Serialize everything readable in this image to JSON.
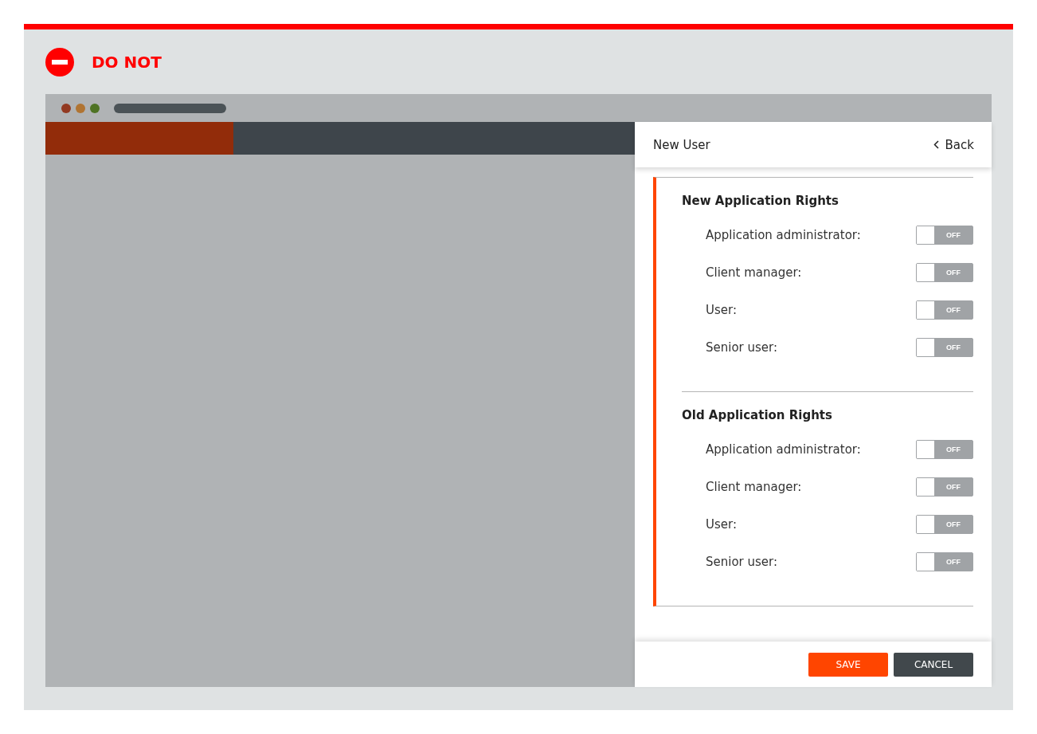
{
  "banner": {
    "label": "DO NOT"
  },
  "panel": {
    "title": "New User",
    "back": "Back",
    "sections": [
      {
        "title": "New Application Rights",
        "rights": [
          {
            "label": "Application administrator:",
            "on": false,
            "state_text": "OFF"
          },
          {
            "label": "Client manager:",
            "on": false,
            "state_text": "OFF"
          },
          {
            "label": "User:",
            "on": false,
            "state_text": "OFF"
          },
          {
            "label": "Senior user:",
            "on": false,
            "state_text": "OFF"
          }
        ]
      },
      {
        "title": "Old Application Rights",
        "rights": [
          {
            "label": "Application administrator:",
            "on": false,
            "state_text": "OFF"
          },
          {
            "label": "Client manager:",
            "on": false,
            "state_text": "OFF"
          },
          {
            "label": "User:",
            "on": false,
            "state_text": "OFF"
          },
          {
            "label": "Senior user:",
            "on": false,
            "state_text": "OFF"
          }
        ]
      }
    ],
    "buttons": [
      {
        "label": "SAVE",
        "kind": "primary"
      },
      {
        "label": "CANCEL",
        "kind": "secondary"
      }
    ]
  }
}
